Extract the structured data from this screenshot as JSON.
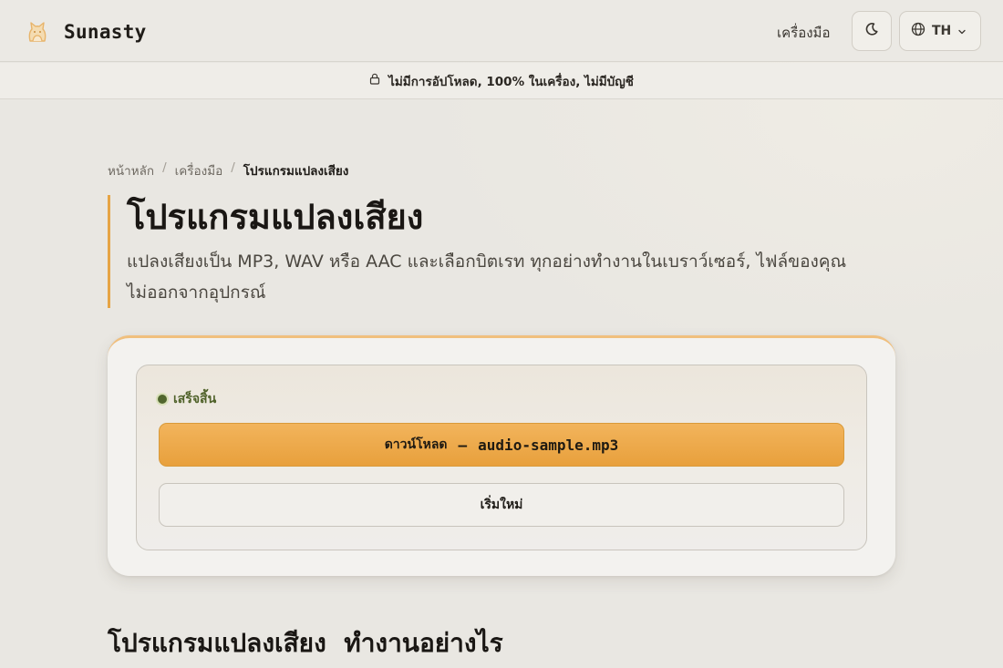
{
  "header": {
    "brand": "Sunasty",
    "nav_tools": "เครื่องมือ",
    "language": "TH",
    "icons": {
      "logo": "cat-logo-icon",
      "theme": "moon-icon",
      "language": "globe-icon",
      "dropdown": "chevron-down-icon"
    }
  },
  "notice": {
    "icon": "lock-icon",
    "text": "ไม่มีการอัปโหลด, 100% ในเครื่อง, ไม่มีบัญชี"
  },
  "breadcrumb": {
    "home": "หน้าหลัก",
    "separator": "/",
    "tools": "เครื่องมือ",
    "current": "โปรแกรมแปลงเสียง"
  },
  "hero": {
    "title": "โปรแกรมแปลงเสียง",
    "description": "แปลงเสียงเป็น MP3, WAV หรือ AAC และเลือกบิตเรท ทุกอย่างทำงานในเบราว์เซอร์, ไฟล์ของคุณไม่ออกจากอุปกรณ์"
  },
  "result": {
    "status": "เสร็จสิ้น",
    "download_label": "ดาวน์โหลด",
    "download_separator": "—",
    "download_filename": "audio-sample.mp3",
    "restart_label": "เริ่มใหม่"
  },
  "how_it_works": {
    "title": "โปรแกรมแปลงเสียง  ทำงานอย่างไร"
  },
  "colors": {
    "accent": "#e8a03c",
    "status_green": "#4f6129",
    "background": "#e9e7e2"
  }
}
